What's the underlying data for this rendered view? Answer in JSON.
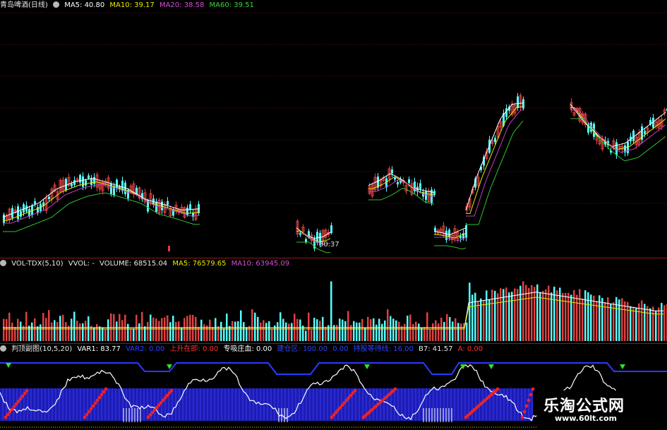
{
  "price_panel": {
    "stock_name": "青岛啤酒(日线)",
    "ma5_label": "MA5: 40.80",
    "ma10_label": "MA10: 39.17",
    "ma20_label": "MA20: 38.58",
    "ma60_label": "MA60: 39.51",
    "low_label": "30.37",
    "colors": {
      "ma5": "#ffffff",
      "ma10": "#e8e800",
      "ma20": "#c040c0",
      "ma60": "#30c030",
      "up": "#e04040",
      "down": "#54ffff"
    }
  },
  "volume_panel": {
    "indicator_name": "VOL-TDX(5,10)",
    "vvol_label": "VVOL: -",
    "volume_label": "VOLUME: 68515.04",
    "ma5_label": "MA5: 76579.65",
    "ma10_label": "MA10: 63945.09"
  },
  "sub_panel": {
    "indicator_name": "判顶副图(10,5,20)",
    "var1_label": "VAR1: 83.77",
    "var2_label": "VAR2: 0.00",
    "rise_label": "上升在即: 0.00",
    "dealer_label": "专吸庄血: 0.00",
    "field4_label": "建仓区: 100.00",
    "field5_label": "0.00",
    "field6_label": "持股等待线: 16.00",
    "b7_label": "B7: 41.57",
    "a_label": "A: 0.00"
  },
  "watermark": {
    "title": "乐淘公式网",
    "url": "www.60lt.com"
  }
}
